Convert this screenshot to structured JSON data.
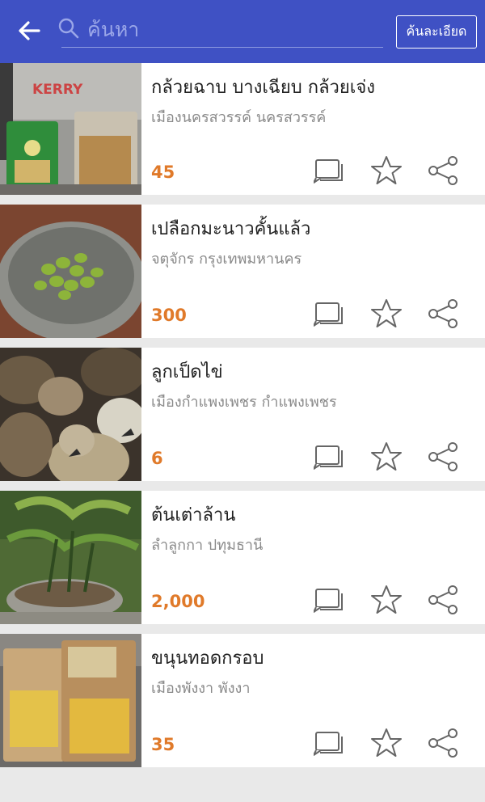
{
  "header": {
    "search_placeholder": "ค้นหา",
    "advanced_label": "ค้นละเอียด"
  },
  "colors": {
    "header_bg": "#3f51c4",
    "price": "#e07a2a"
  },
  "items": [
    {
      "title": "กล้วยฉาบ บางเฉียบ กล้วยเจ่ง",
      "location": "เมืองนครสวรรค์ นครสวรรค์",
      "price": "45",
      "image": "banana-chips-bags-photo"
    },
    {
      "title": "เปลือกมะนาวคั้นแล้ว",
      "location": "จตุจักร กรุงเทพมหานคร",
      "price": "300",
      "image": "lime-peels-bowl-photo"
    },
    {
      "title": "ลูกเป็ดไข่",
      "location": "เมืองกำแพงเพชร กำแพงเพชร",
      "price": "6",
      "image": "ducklings-photo"
    },
    {
      "title": "ต้นเต่าล้าน",
      "location": "ลำลูกกา ปทุมธานี",
      "price": "2,000",
      "image": "plant-pot-photo"
    },
    {
      "title": "ขนุนทอดกรอบ",
      "location": "เมืองพังงา พังงา",
      "price": "35",
      "image": "jackfruit-chips-photo"
    }
  ],
  "icons": [
    "back-arrow-icon",
    "search-icon",
    "comment-icon",
    "star-icon",
    "share-icon"
  ]
}
